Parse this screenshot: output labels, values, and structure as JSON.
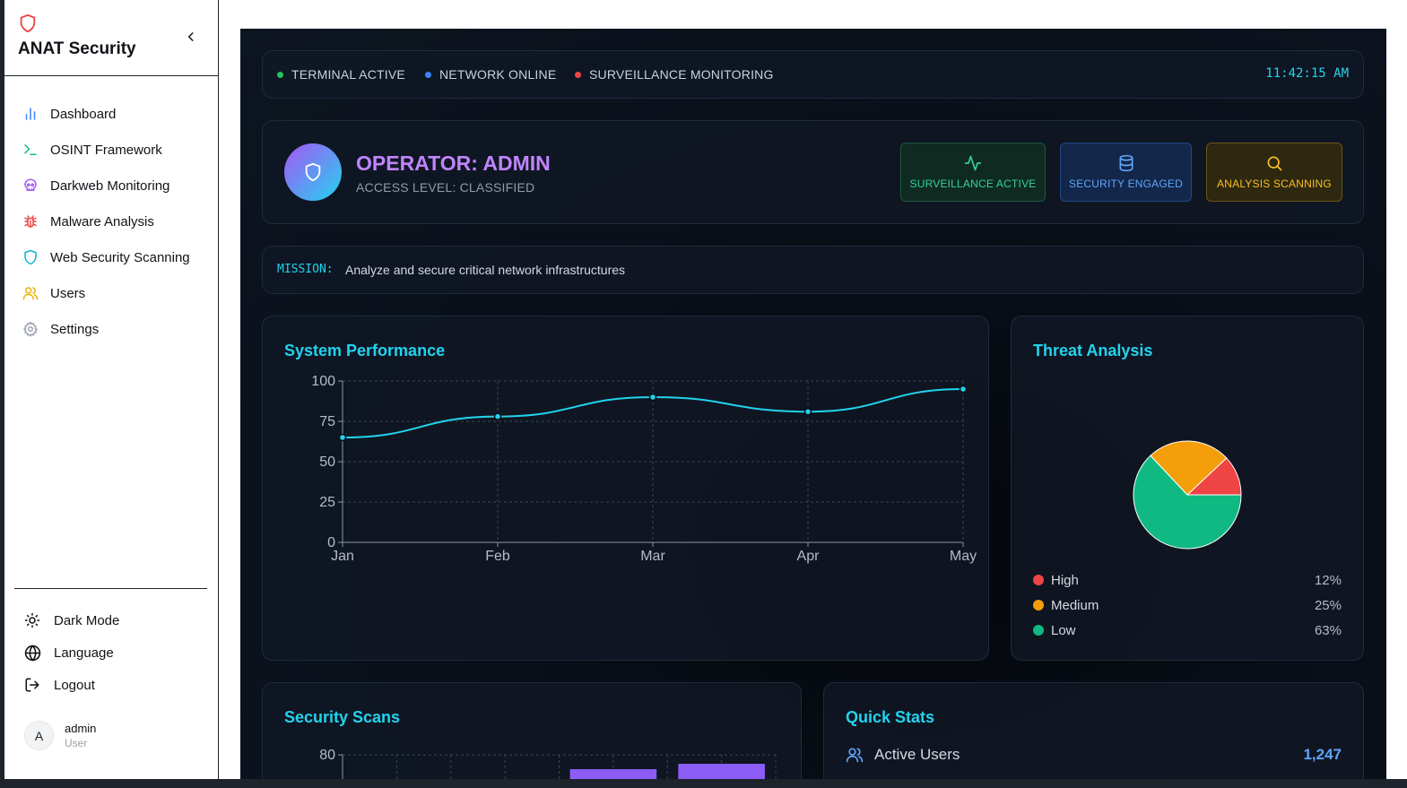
{
  "app": {
    "name": "ANAT Security"
  },
  "sidebar": {
    "items": [
      {
        "label": "Dashboard",
        "icon": "bar-chart-icon"
      },
      {
        "label": "OSINT Framework",
        "icon": "terminal-icon"
      },
      {
        "label": "Darkweb Monitoring",
        "icon": "skull-icon"
      },
      {
        "label": "Malware Analysis",
        "icon": "bug-icon"
      },
      {
        "label": "Web Security Scanning",
        "icon": "shield-icon"
      },
      {
        "label": "Users",
        "icon": "users-icon"
      },
      {
        "label": "Settings",
        "icon": "gear-icon"
      }
    ],
    "bottom": {
      "dark_mode": "Dark Mode",
      "language": "Language",
      "logout": "Logout"
    },
    "user": {
      "initial": "A",
      "name": "admin",
      "role": "User"
    }
  },
  "status_bar": {
    "items": [
      {
        "label": "TERMINAL ACTIVE",
        "color": "#22c55e"
      },
      {
        "label": "NETWORK ONLINE",
        "color": "#3b82f6"
      },
      {
        "label": "SURVEILLANCE MONITORING",
        "color": "#ef4444"
      }
    ],
    "clock": "11:42:15 AM"
  },
  "operator": {
    "title": "OPERATOR: ADMIN",
    "access": "ACCESS LEVEL: CLASSIFIED",
    "modes": [
      {
        "label": "SURVEILLANCE ACTIVE",
        "icon": "activity-icon"
      },
      {
        "label": "SECURITY ENGAGED",
        "icon": "database-icon"
      },
      {
        "label": "ANALYSIS SCANNING",
        "icon": "search-icon"
      }
    ]
  },
  "mission": {
    "key": "MISSION:",
    "text": "Analyze and secure critical network infrastructures"
  },
  "panels": {
    "performance_title": "System Performance",
    "threat_title": "Threat Analysis",
    "scans_title": "Security Scans",
    "quick_title": "Quick Stats"
  },
  "chart_data": [
    {
      "type": "line",
      "title": "System Performance",
      "x": [
        "Jan",
        "Feb",
        "Mar",
        "Apr",
        "May"
      ],
      "y_ticks": [
        0,
        25,
        50,
        75,
        100
      ],
      "ylim": [
        0,
        100
      ],
      "series": [
        {
          "values": [
            65,
            78,
            90,
            81,
            95
          ],
          "color": "#22d3ee"
        }
      ],
      "grid": true
    },
    {
      "type": "pie",
      "title": "Threat Analysis",
      "slices": [
        {
          "label": "High",
          "value": 12,
          "display": "12%",
          "color": "#ef4444"
        },
        {
          "label": "Medium",
          "value": 25,
          "display": "25%",
          "color": "#f59e0b"
        },
        {
          "label": "Low",
          "value": 63,
          "display": "63%",
          "color": "#10b981"
        }
      ]
    },
    {
      "type": "bar",
      "title": "Security Scans",
      "y_ticks": [
        80
      ],
      "ylim": [
        0,
        80
      ],
      "values": [
        null,
        null,
        72,
        75
      ],
      "color": "#8b5cf6",
      "grid": true
    }
  ],
  "quick_stats": [
    {
      "label": "Active Users",
      "value": "1,247",
      "icon": "users-icon"
    }
  ]
}
